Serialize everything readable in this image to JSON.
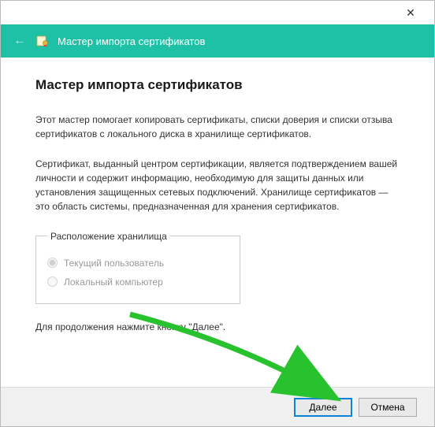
{
  "header": {
    "title": "Мастер импорта сертификатов"
  },
  "main": {
    "heading": "Мастер импорта сертификатов",
    "intro": "Этот мастер помогает копировать сертификаты, списки доверия и списки отзыва сертификатов с локального диска в хранилище сертификатов.",
    "description": "Сертификат, выданный центром сертификации, является подтверждением вашей личности и содержит информацию, необходимую для защиты данных или установления защищенных сетевых подключений. Хранилище сертификатов — это область системы, предназначенная для хранения сертификатов.",
    "storage": {
      "legend": "Расположение хранилища",
      "options": [
        {
          "label": "Текущий пользователь",
          "selected": true
        },
        {
          "label": "Локальный компьютер",
          "selected": false
        }
      ]
    },
    "continue_hint": "Для продолжения нажмите кнопку \"Далее\"."
  },
  "footer": {
    "next": "Далее",
    "cancel": "Отмена"
  }
}
